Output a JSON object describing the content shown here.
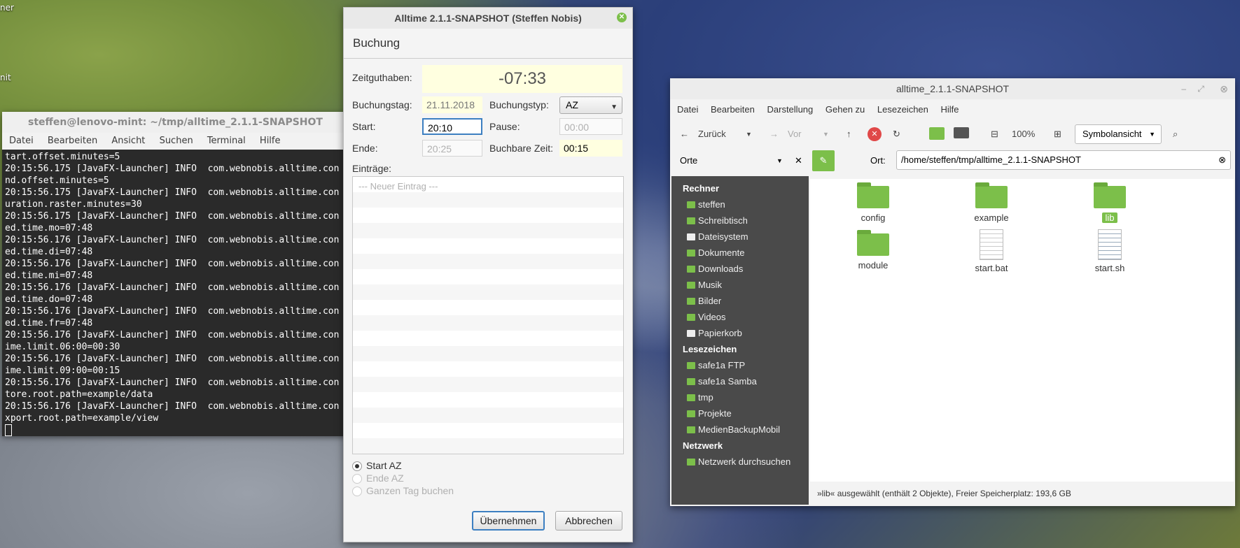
{
  "desktop": {
    "label_top": "ner",
    "label_mid": "nit"
  },
  "terminal": {
    "title": "steffen@lenovo-mint: ~/tmp/alltime_2.1.1-SNAPSHOT",
    "menu": [
      "Datei",
      "Bearbeiten",
      "Ansicht",
      "Suchen",
      "Terminal",
      "Hilfe"
    ],
    "lines": [
      "tart.offset.minutes=5",
      "20:15:56.175 [JavaFX-Launcher] INFO  com.webnobis.alltime.con",
      "nd.offset.minutes=5",
      "20:15:56.175 [JavaFX-Launcher] INFO  com.webnobis.alltime.con",
      "uration.raster.minutes=30",
      "20:15:56.175 [JavaFX-Launcher] INFO  com.webnobis.alltime.con",
      "ed.time.mo=07:48",
      "20:15:56.176 [JavaFX-Launcher] INFO  com.webnobis.alltime.con",
      "ed.time.di=07:48",
      "20:15:56.176 [JavaFX-Launcher] INFO  com.webnobis.alltime.con",
      "ed.time.mi=07:48",
      "20:15:56.176 [JavaFX-Launcher] INFO  com.webnobis.alltime.con",
      "ed.time.do=07:48",
      "20:15:56.176 [JavaFX-Launcher] INFO  com.webnobis.alltime.con",
      "ed.time.fr=07:48",
      "20:15:56.176 [JavaFX-Launcher] INFO  com.webnobis.alltime.con",
      "ime.limit.06:00=00:30",
      "20:15:56.176 [JavaFX-Launcher] INFO  com.webnobis.alltime.con",
      "ime.limit.09:00=00:15",
      "20:15:56.176 [JavaFX-Launcher] INFO  com.webnobis.alltime.con",
      "tore.root.path=example/data",
      "20:15:56.176 [JavaFX-Launcher] INFO  com.webnobis.alltime.con",
      "xport.root.path=example/view"
    ]
  },
  "alltime": {
    "title": "Alltime 2.1.1-SNAPSHOT (Steffen Nobis)",
    "header": "Buchung",
    "balance_label": "Zeitguthaben:",
    "balance_value": "-07:33",
    "day_label": "Buchungstag:",
    "day_value": "21.11.2018",
    "type_label": "Buchungstyp:",
    "type_value": "AZ",
    "start_label": "Start:",
    "start_value": "20:10",
    "pause_label": "Pause:",
    "pause_placeholder": "00:00",
    "end_label": "Ende:",
    "end_placeholder": "20:25",
    "bookable_label": "Buchbare Zeit:",
    "bookable_value": "00:15",
    "entries_label": "Einträge:",
    "entries_placeholder": "--- Neuer Eintrag ---",
    "radios": [
      "Start AZ",
      "Ende AZ",
      "Ganzen Tag buchen"
    ],
    "apply_button": "Übernehmen",
    "cancel_button": "Abbrechen"
  },
  "filemanager": {
    "title": "alltime_2.1.1-SNAPSHOT",
    "menu": [
      "Datei",
      "Bearbeiten",
      "Darstellung",
      "Gehen zu",
      "Lesezeichen",
      "Hilfe"
    ],
    "back_label": "Zurück",
    "forward_label": "Vor",
    "zoom": "100%",
    "view_mode": "Symbolansicht",
    "places_label": "Orte",
    "location_label": "Ort:",
    "location_value": "/home/steffen/tmp/alltime_2.1.1-SNAPSHOT",
    "sections": [
      {
        "title": "Rechner",
        "items": [
          "steffen",
          "Schreibtisch",
          "Dateisystem",
          "Dokumente",
          "Downloads",
          "Musik",
          "Bilder",
          "Videos",
          "Papierkorb"
        ]
      },
      {
        "title": "Lesezeichen",
        "items": [
          "safe1a FTP",
          "safe1a Samba",
          "tmp",
          "Projekte",
          "MedienBackupMobil"
        ]
      },
      {
        "title": "Netzwerk",
        "items": [
          "Netzwerk durchsuchen"
        ]
      }
    ],
    "files": [
      {
        "name": "config",
        "kind": "folder"
      },
      {
        "name": "example",
        "kind": "folder"
      },
      {
        "name": "lib",
        "kind": "folder"
      },
      {
        "name": "module",
        "kind": "folder"
      },
      {
        "name": "start.bat",
        "kind": "document"
      },
      {
        "name": "start.sh",
        "kind": "script"
      }
    ],
    "status": "»lib« ausgewählt (enthält 2 Objekte), Freier Speicherplatz: 193,6 GB"
  }
}
